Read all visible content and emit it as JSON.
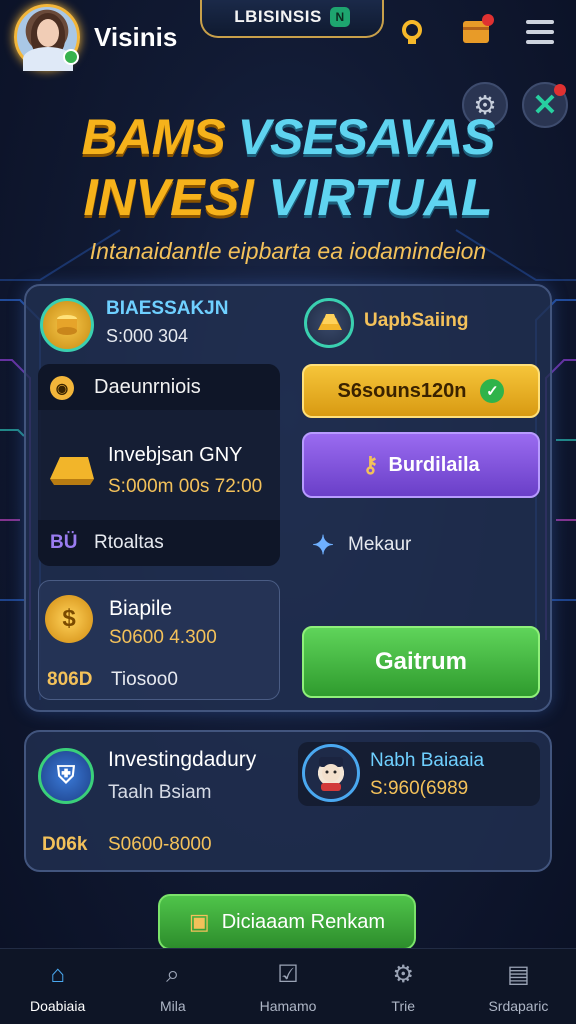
{
  "header": {
    "username": "Visinis",
    "brand": "LBISINSIS",
    "brand_badge": "N"
  },
  "hero": {
    "line1_a": "BAMS",
    "line1_b": "VSESAVAS",
    "line2_a": "INVESI",
    "line2_b": "VIRTUAL",
    "tagline": "Intanaidantle eipbarta ea iodamindeion"
  },
  "main": {
    "balance": {
      "title": "BIAESSAKJN",
      "value": "S:000 304"
    },
    "upgrade_label": "UapbSaiing",
    "section_label": "Daeunrniois",
    "invest": {
      "title": "Invebjsan GNY",
      "value": "S:000m 00s 72:00"
    },
    "amount_button": "S6souns120n",
    "bundle_button": "Burdilaila",
    "rewards": {
      "prefix": "BÜ",
      "label": "Rtoaltas"
    },
    "menu_label": "Mekaur",
    "bonus": {
      "title": "Biapile",
      "value": "S0600 4.300"
    },
    "footer_row": {
      "prefix": "806D",
      "label": "Tiosoo0"
    },
    "claim_button": "Gaitrum"
  },
  "bottom_panel": {
    "left": {
      "title": "Investingdadury",
      "subtitle": "Taaln Bsiam",
      "prefix": "D06k",
      "value": "S0600-8000"
    },
    "right": {
      "name": "Nabh Baiaaia",
      "value": "S:960(6989"
    }
  },
  "cta": {
    "label": "Diciaaam Renkam"
  },
  "nav": [
    {
      "label": "Doabiaia",
      "icon": "home-icon"
    },
    {
      "label": "Mila",
      "icon": "search-icon"
    },
    {
      "label": "Hamamo",
      "icon": "check-box-icon"
    },
    {
      "label": "Trie",
      "icon": "gear-icon"
    },
    {
      "label": "Srdaparic",
      "icon": "archive-icon"
    }
  ]
}
